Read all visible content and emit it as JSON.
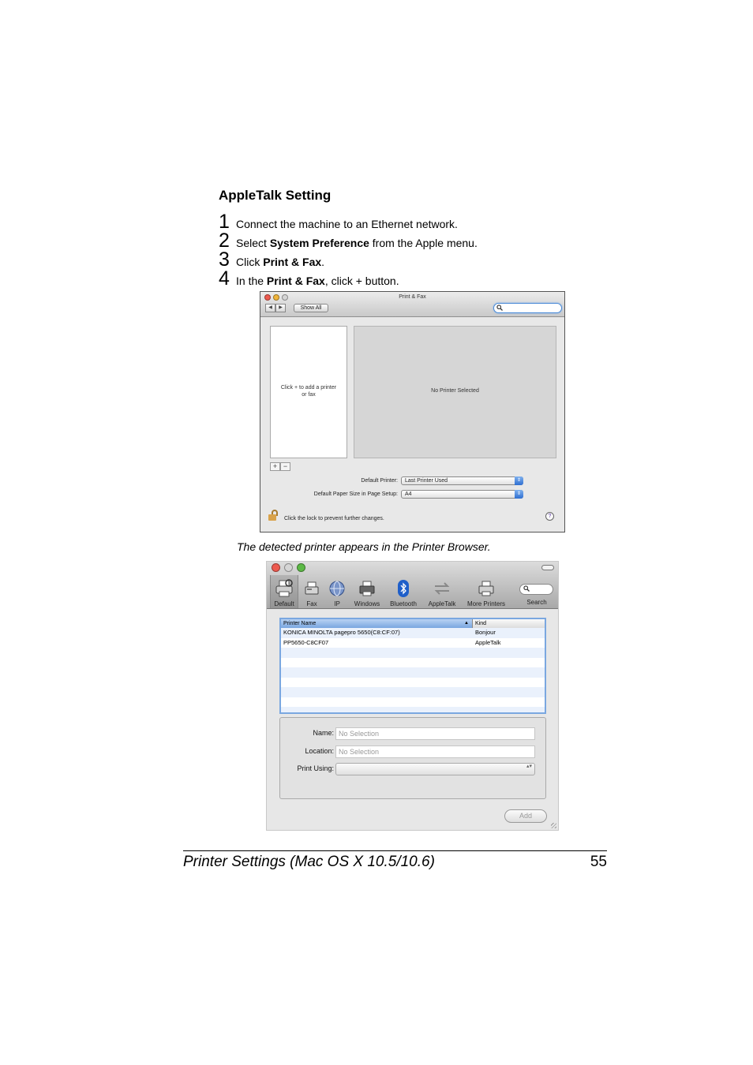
{
  "section_title": "AppleTalk Setting",
  "steps": [
    {
      "num": "1",
      "pre": "Connect the machine to an Ethernet network.",
      "bold": "",
      "post": ""
    },
    {
      "num": "2",
      "pre": "Select ",
      "bold": "System Preference",
      "post": " from the Apple menu."
    },
    {
      "num": "3",
      "pre": "Click ",
      "bold": "Print & Fax",
      "post": "."
    },
    {
      "num": "4",
      "pre": "In the ",
      "bold": "Print & Fax",
      "post": ", click + button."
    }
  ],
  "print_fax_window": {
    "title": "Print & Fax",
    "back_glyph": "◀",
    "forward_glyph": "▶",
    "show_all_label": "Show All",
    "search_icon": "magnifier-icon",
    "printer_list_hint": "Click + to add a printer or fax",
    "detail_message": "No Printer Selected",
    "add_glyph": "+",
    "remove_glyph": "−",
    "default_printer_label": "Default Printer:",
    "default_printer_value": "Last Printer Used",
    "paper_size_label": "Default Paper Size in Page Setup:",
    "paper_size_value": "A4",
    "popup_arrow_glyph": "⇕",
    "lock_text": "Click the lock to prevent further changes.",
    "help_glyph": "?"
  },
  "caption": "The detected printer appears in the Printer Browser.",
  "printer_browser": {
    "toolbar": [
      {
        "name": "default",
        "label": "Default"
      },
      {
        "name": "fax",
        "label": "Fax"
      },
      {
        "name": "ip",
        "label": "IP"
      },
      {
        "name": "windows",
        "label": "Windows"
      },
      {
        "name": "bluetooth",
        "label": "Bluetooth"
      },
      {
        "name": "appletalk",
        "label": "AppleTalk"
      },
      {
        "name": "more-printers",
        "label": "More Printers"
      },
      {
        "name": "search",
        "label": "Search"
      }
    ],
    "table": {
      "headers": [
        "Printer Name",
        "Kind"
      ],
      "sort_glyph": "▲",
      "rows": [
        {
          "name": "KONICA MINOLTA pagepro 5650(C8:CF:07)",
          "kind": "Bonjour"
        },
        {
          "name": "PP5650-C8CF07",
          "kind": "AppleTalk"
        }
      ]
    },
    "name_label": "Name:",
    "name_placeholder": "No Selection",
    "location_label": "Location:",
    "location_placeholder": "No Selection",
    "print_using_label": "Print Using:",
    "stepper_glyph": "▴▾",
    "add_button_label": "Add"
  },
  "footer": {
    "left": "Printer Settings (Mac OS X 10.5/10.6)",
    "page_number": "55"
  }
}
